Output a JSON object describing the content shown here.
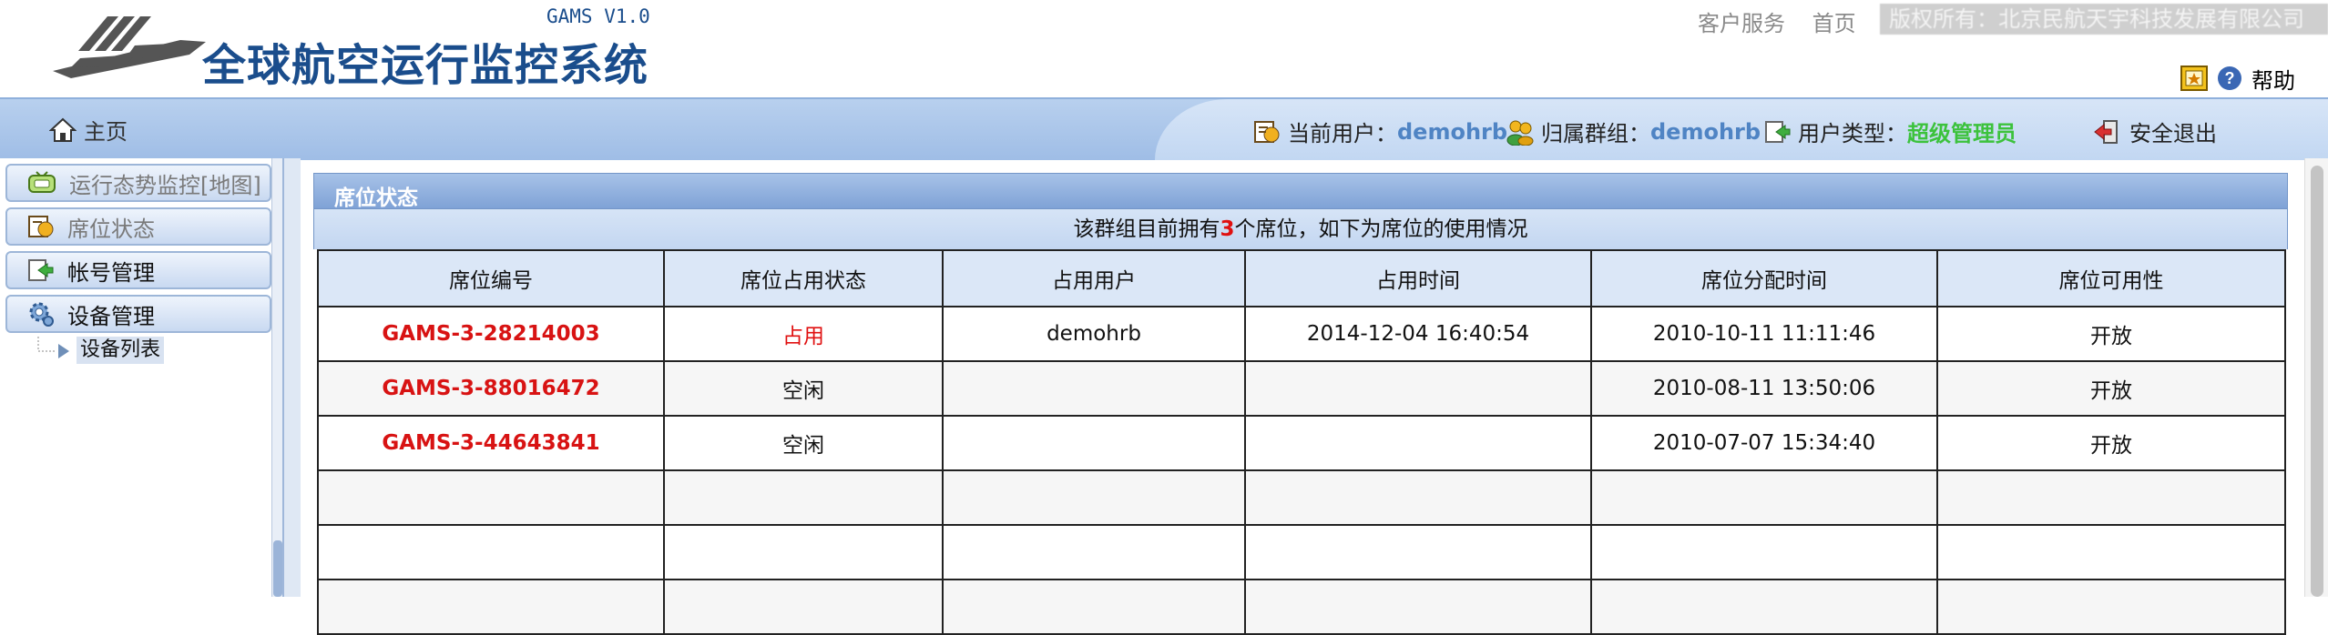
{
  "header": {
    "app_title": "全球航空运行监控系统",
    "version": "GAMS V1.0",
    "links": [
      "客户服务",
      "首页"
    ],
    "copyright": "版权所有：北京民航天宇科技发展有限公司",
    "help_label": "帮助"
  },
  "navbar": {
    "home_label": "主页",
    "current_user_label": "当前用户：",
    "current_user": "demohrb",
    "group_label": "归属群组：",
    "group": "demohrb",
    "user_type_label": "用户类型：",
    "user_type": "超级管理员",
    "logout_label": "安全退出"
  },
  "sidebar": {
    "items": [
      {
        "label": "运行态势监控[地图]"
      },
      {
        "label": "席位状态"
      },
      {
        "label": "帐号管理"
      },
      {
        "label": "设备管理"
      }
    ],
    "sub_item": "设备列表"
  },
  "panel": {
    "title": "席位状态",
    "summary_prefix": "该群组目前拥有",
    "summary_count": "3",
    "summary_suffix": "个席位，如下为席位的使用情况",
    "columns": [
      "席位编号",
      "席位占用状态",
      "占用用户",
      "占用时间",
      "席位分配时间",
      "席位可用性"
    ],
    "rows": [
      [
        "GAMS-3-28214003",
        "占用",
        "demohrb",
        "2014-12-04 16:40:54",
        "2010-10-11 11:11:46",
        "开放"
      ],
      [
        "GAMS-3-88016472",
        "空闲",
        "",
        "",
        "2010-08-11 13:50:06",
        "开放"
      ],
      [
        "GAMS-3-44643841",
        "空闲",
        "",
        "",
        "2010-07-07 15:34:40",
        "开放"
      ]
    ]
  },
  "colors": {
    "accent_blue": "#4f84c4",
    "admin_green": "#3cc23c",
    "alert_red": "#e01010",
    "title_blue": "#1a4d8c"
  }
}
